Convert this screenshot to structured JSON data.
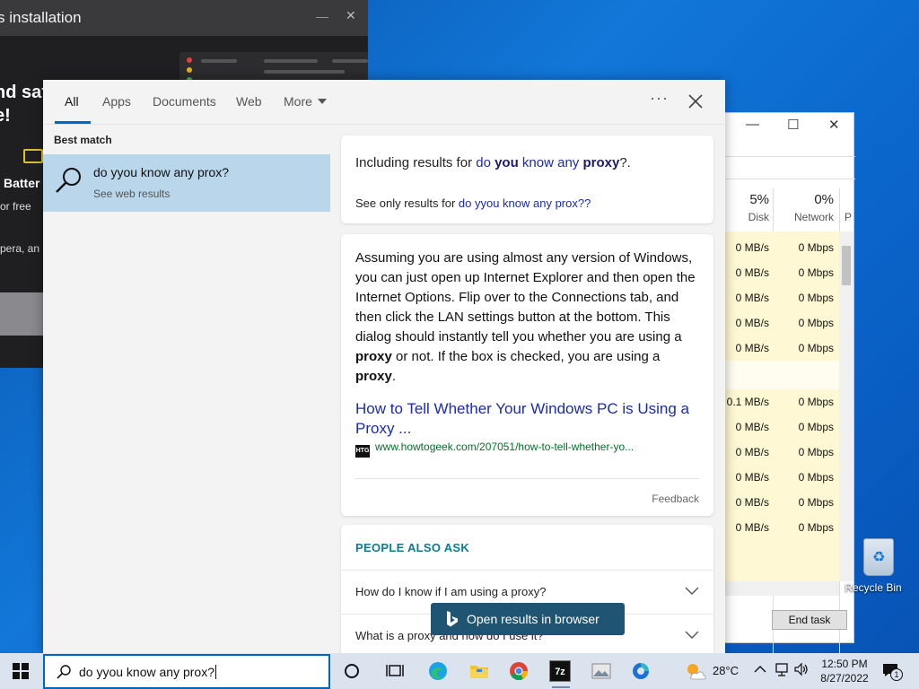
{
  "installer": {
    "title": "s installation",
    "minimize": "—",
    "close": "✕",
    "tagline_line1": "nd saf",
    "tagline_line2": "e!",
    "battery": "Batter",
    "free": "or free",
    "opera": "pera, an"
  },
  "task_manager": {
    "columns": [
      {
        "pct": "5%",
        "label": "Disk"
      },
      {
        "pct": "0%",
        "label": "Network"
      },
      {
        "pct": "",
        "label": "P"
      }
    ],
    "disk_values": [
      "0 MB/s",
      "0 MB/s",
      "0 MB/s",
      "0 MB/s",
      "0 MB/s",
      "0.1 MB/s",
      "0 MB/s",
      "0 MB/s",
      "0 MB/s",
      "0 MB/s",
      "0 MB/s"
    ],
    "network_values": [
      "0 Mbps",
      "0 Mbps",
      "0 Mbps",
      "0 Mbps",
      "0 Mbps",
      "0 Mbps",
      "0 Mbps",
      "0 Mbps",
      "0 Mbps",
      "0 Mbps",
      "0 Mbps"
    ],
    "end_task_label": "End task",
    "minimize": "—",
    "maximize": "☐",
    "close": "✕"
  },
  "desktop": {
    "recycle_bin_label": "Recycle Bin"
  },
  "search": {
    "tabs": [
      {
        "label": "All",
        "active": true
      },
      {
        "label": "Apps"
      },
      {
        "label": "Documents"
      },
      {
        "label": "Web"
      },
      {
        "label": "More"
      }
    ],
    "ellipsis": "···",
    "best_match_label": "Best match",
    "best_match": {
      "query": "do yyou know any prox?",
      "sub": "See web results"
    },
    "including": {
      "prefix": "Including results for ",
      "q1": "do ",
      "q2": "you",
      "q3": " know any ",
      "q4": "proxy",
      "suffix": "?."
    },
    "only": {
      "prefix": "See only results for ",
      "query": "do yyou know any prox??"
    },
    "answer": {
      "part1": "Assuming you are using almost any version of Windows, you can just open up Internet Explorer and then open the Internet Options. Flip over to the Connections tab, and then click the LAN settings button at the bottom. This dialog should instantly tell you whether you are using a ",
      "bold1": "proxy",
      "part2": " or not. If the box is checked, you are using a ",
      "bold2": "proxy",
      "part3": "."
    },
    "source_title": "How to Tell Whether Your Windows PC is Using a Proxy ...",
    "source_badge": "HTG",
    "source_url": "www.howtogeek.com/207051/how-to-tell-whether-yo...",
    "feedback": "Feedback",
    "people_also_ask": "PEOPLE ALSO ASK",
    "questions": [
      "How do I know if I am using a proxy?",
      "What is a proxy and how do I use it?"
    ],
    "open_in_browser": "Open results in browser"
  },
  "taskbar": {
    "search_value": "do yyou know any prox?",
    "weather_temp": "28°C",
    "time": "12:50 PM",
    "date": "8/27/2022",
    "notification_count": "1",
    "zip_label": "7z"
  }
}
